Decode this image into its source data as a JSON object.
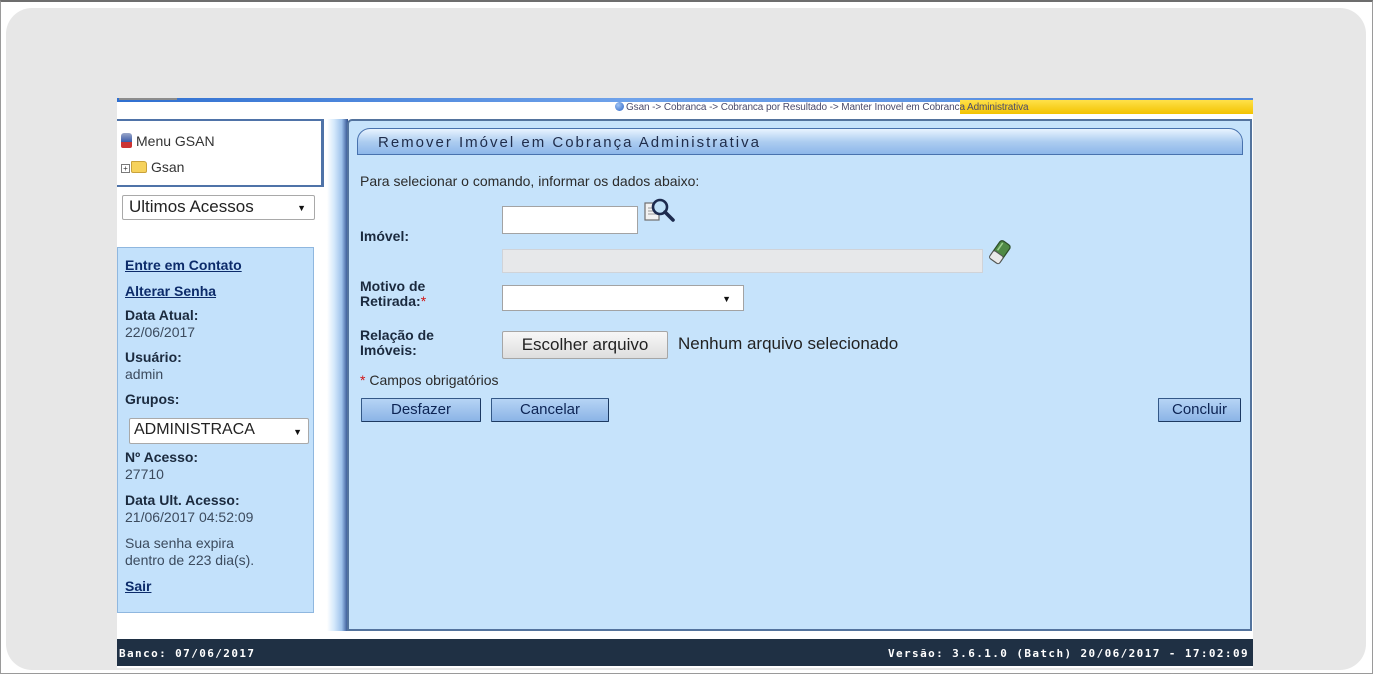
{
  "breadcrumb": "Gsan -> Cobranca -> Cobranca por Resultado -> Manter Imovel em Cobranca Administrativa",
  "sidebar": {
    "menu_title": "Menu GSAN",
    "tree_root": "Gsan",
    "recent_select": "Ultimos Acessos",
    "contact_link": "Entre em Contato",
    "change_password_link": "Alterar Senha",
    "current_date_label": "Data Atual:",
    "current_date": "22/06/2017",
    "user_label": "Usuário:",
    "user": "admin",
    "groups_label": "Grupos:",
    "groups_selected": "ADMINISTRACA",
    "access_number_label": "Nº Acesso:",
    "access_number": "27710",
    "last_access_label": "Data Ult. Acesso:",
    "last_access": "21/06/2017 04:52:09",
    "password_expiry_line1": "Sua senha expira",
    "password_expiry_line2": "dentro de 223 dia(s).",
    "logout_link": "Sair"
  },
  "form": {
    "title": "Remover Imóvel em Cobrança Administrativa",
    "instruction": "Para selecionar o comando, informar os dados abaixo:",
    "imovel_label": "Imóvel:",
    "imovel_value": "",
    "imovel_description": "",
    "motivo_label_line1": "Motivo de",
    "motivo_label_line2": "Retirada:",
    "motivo_selected": "",
    "relacao_label_line1": "Relação de",
    "relacao_label_line2": "Imóveis:",
    "file_button": "Escolher arquivo",
    "file_status": "Nenhum arquivo selecionado",
    "required_star": "*",
    "required_note": "Campos obrigatórios",
    "undo_button": "Desfazer",
    "cancel_button": "Cancelar",
    "submit_button": "Concluir"
  },
  "footer": {
    "db_date": "Banco: 07/06/2017",
    "version": "Versão: 3.6.1.0 (Batch) 20/06/2017 - 17:02:09"
  },
  "colors": {
    "panel_bg": "#c6e3fb",
    "sidebar_panel_bg": "#c3e1fb",
    "footer_bg": "#1f3044",
    "button_bg": "#8bb4e6",
    "breadcrumb_highlight": "#ffe14a",
    "required_star": "#d01414"
  },
  "icons": [
    "menu-icon",
    "plus-icon",
    "folder-icon",
    "search-icon",
    "eraser-icon",
    "globe-icon",
    "chevron-down-icon"
  ]
}
